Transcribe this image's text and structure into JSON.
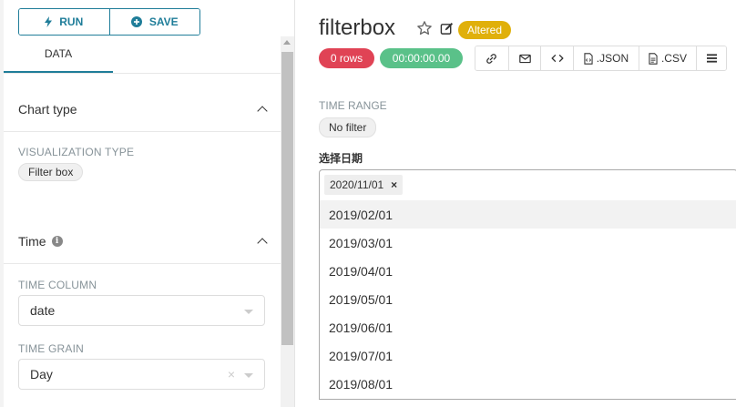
{
  "controls": {
    "run_label": "RUN",
    "save_label": "SAVE",
    "tab_data": "DATA"
  },
  "sections": {
    "chart_type": {
      "title": "Chart type",
      "viz_label": "VISUALIZATION TYPE",
      "viz_value": "Filter box"
    },
    "time": {
      "title": "Time",
      "column_label": "TIME COLUMN",
      "column_value": "date",
      "grain_label": "TIME GRAIN",
      "grain_value": "Day"
    }
  },
  "header": {
    "title": "filterbox",
    "badge": "Altered",
    "rows": "0 rows",
    "duration": "00:00:00.00",
    "json_label": ".JSON",
    "csv_label": ".CSV"
  },
  "filter": {
    "time_range_label": "TIME RANGE",
    "time_range_value": "No filter",
    "date_label": "选择日期",
    "selected_tag": "2020/11/01",
    "remove_symbol": "×",
    "options": [
      "2019/02/01",
      "2019/03/01",
      "2019/04/01",
      "2019/05/01",
      "2019/06/01",
      "2019/07/01",
      "2019/08/01"
    ]
  },
  "colors": {
    "primary": "#1f7d99",
    "danger": "#e04355",
    "success": "#5ac189",
    "warning": "#e0b00a"
  },
  "icons": {
    "run": "bolt-icon",
    "save": "plus-circle-icon",
    "star": "star-icon",
    "edit": "edit-icon",
    "link": "link-icon",
    "email": "envelope-icon",
    "embed": "code-icon",
    "json": "file-code-icon",
    "csv": "file-text-icon",
    "menu": "hamburger-icon",
    "info": "info-circle-icon",
    "collapse": "chevron-up-icon"
  }
}
